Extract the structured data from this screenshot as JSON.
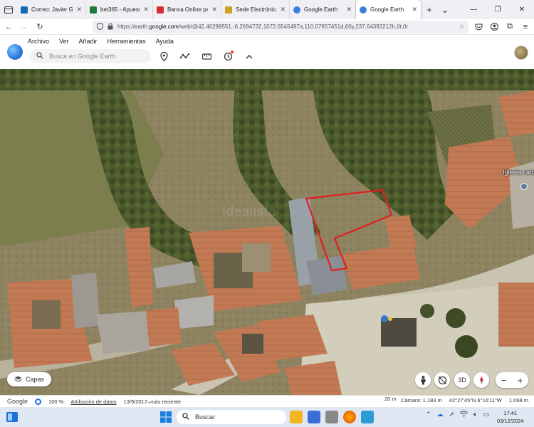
{
  "browser": {
    "tabs": [
      {
        "title": "Correo: Javier Gonz",
        "favicon_color": "#0f6cbd",
        "active": false
      },
      {
        "title": "bet365 - Apuestas d",
        "favicon_color": "#1e7a3c",
        "active": false
      },
      {
        "title": "Banca Online para e",
        "favicon_color": "#d62d2d",
        "active": false
      },
      {
        "title": "Sede Electrónica de",
        "favicon_color": "#c9a227",
        "active": false
      },
      {
        "title": "Google Earth",
        "favicon_color": "#3d7de0",
        "active": false
      },
      {
        "title": "Google Earth",
        "favicon_color": "#3d7de0",
        "active": true
      }
    ],
    "url_prefix": "https://earth.",
    "url_host": "google.com",
    "url_rest": "/web/@42.46298551,-6.2694732,1072.6545487a,110.07957451d,60y,237.64393212h,0t,0r"
  },
  "app": {
    "menu": [
      "Archivo",
      "Ver",
      "Añadir",
      "Herramientas",
      "Ayuda"
    ],
    "search_placeholder": "Busca en Google Earth"
  },
  "map": {
    "watermark": "Idealista",
    "place_label": "Iglesia cató",
    "layers_label": "Capas",
    "view_3d_label": "3D",
    "scale_label": "20 m"
  },
  "status": {
    "brand": "Google",
    "zoom": "100 %",
    "attribution": "Atribución de datos",
    "imagery_date": "13/9/2017–más reciente",
    "camera": "Cámara: 1.183 m",
    "coordinates": "42°27'45\"N 6°16'11\"W",
    "elevation": "1.068 m"
  },
  "taskbar": {
    "search_label": "Buscar",
    "time": "17:41",
    "date": "03/12/2024"
  }
}
